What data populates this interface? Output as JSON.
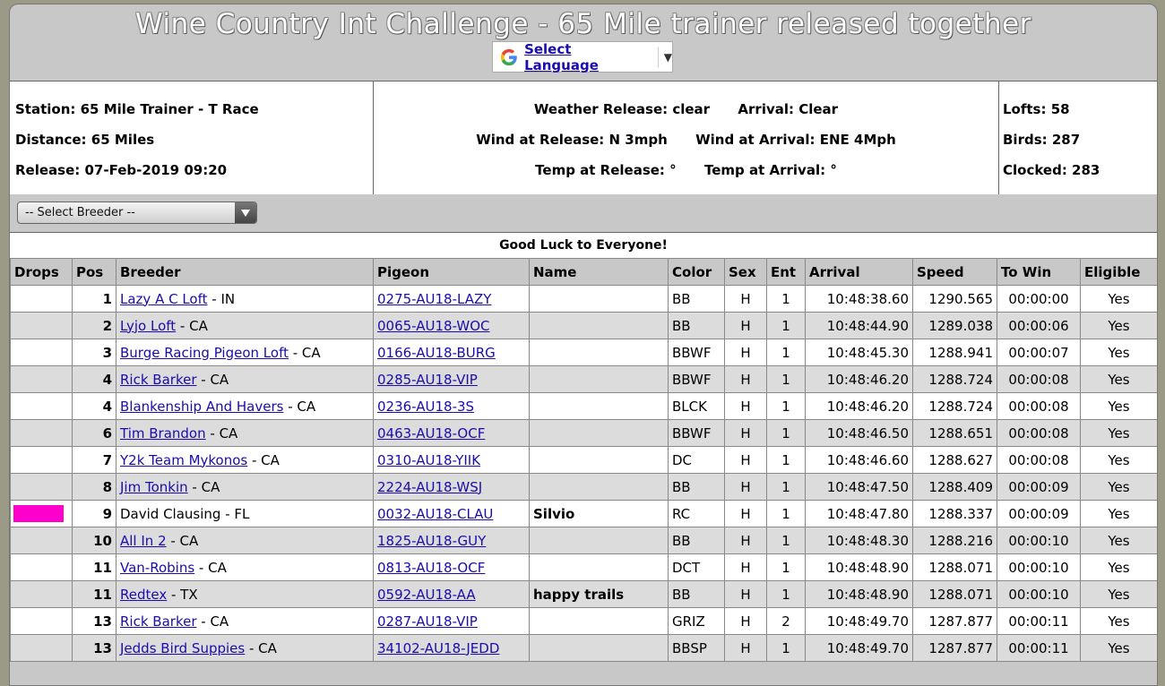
{
  "title": "Wine Country Int Challenge - 65 Mile trainer released together",
  "language": {
    "label": "Select Language",
    "arrow": "▼"
  },
  "info": {
    "station": "Station: 65 Mile Trainer - T Race",
    "distance": "Distance: 65 Miles",
    "release": "Release: 07-Feb-2019 09:20",
    "weather": "Weather Release: clear      Arrival: Clear",
    "wind": "Wind at Release: N 3mph      Wind at Arrival: ENE 4Mph",
    "temp": "Temp at Release: °      Temp at Arrival: °",
    "lofts": "Lofts: 58",
    "birds": "Birds: 287",
    "clocked": "Clocked: 283"
  },
  "breeder_select": "-- Select Breeder --",
  "message": "Good Luck to Everyone!",
  "columns": [
    "Drops",
    "Pos",
    "Breeder",
    "Pigeon",
    "Name",
    "Color",
    "Sex",
    "Ent",
    "Arrival",
    "Speed",
    "To Win",
    "Eligible"
  ],
  "colors": {
    "drop_highlight": "#ff00cc",
    "link": "#1a0dab"
  },
  "rows": [
    {
      "drop": "",
      "pos": "1",
      "breeder": "Lazy A C Loft",
      "breeder_link": true,
      "state": " - IN",
      "pigeon": "0275-AU18-LAZY",
      "name": "",
      "color": "BB",
      "sex": "H",
      "ent": "1",
      "arrival": "10:48:38.60",
      "speed": "1290.565",
      "towin": "00:00:00",
      "eligible": "Yes"
    },
    {
      "drop": "",
      "pos": "2",
      "breeder": "Lyjo Loft",
      "breeder_link": true,
      "state": " - CA",
      "pigeon": "0065-AU18-WOC",
      "name": "",
      "color": "BB",
      "sex": "H",
      "ent": "1",
      "arrival": "10:48:44.90",
      "speed": "1289.038",
      "towin": "00:00:06",
      "eligible": "Yes"
    },
    {
      "drop": "",
      "pos": "3",
      "breeder": "Burge Racing Pigeon Loft",
      "breeder_link": true,
      "state": " - CA",
      "pigeon": "0166-AU18-BURG",
      "name": "",
      "color": "BBWF",
      "sex": "H",
      "ent": "1",
      "arrival": "10:48:45.30",
      "speed": "1288.941",
      "towin": "00:00:07",
      "eligible": "Yes"
    },
    {
      "drop": "",
      "pos": "4",
      "breeder": "Rick Barker",
      "breeder_link": true,
      "state": " - CA",
      "pigeon": "0285-AU18-VIP",
      "name": "",
      "color": "BBWF",
      "sex": "H",
      "ent": "1",
      "arrival": "10:48:46.20",
      "speed": "1288.724",
      "towin": "00:00:08",
      "eligible": "Yes"
    },
    {
      "drop": "",
      "pos": "4",
      "breeder": "Blankenship And Havers",
      "breeder_link": true,
      "state": " - CA",
      "pigeon": "0236-AU18-3S",
      "name": "",
      "color": "BLCK",
      "sex": "H",
      "ent": "1",
      "arrival": "10:48:46.20",
      "speed": "1288.724",
      "towin": "00:00:08",
      "eligible": "Yes"
    },
    {
      "drop": "",
      "pos": "6",
      "breeder": "Tim Brandon",
      "breeder_link": true,
      "state": " - CA",
      "pigeon": "0463-AU18-OCF",
      "name": "",
      "color": "BBWF",
      "sex": "H",
      "ent": "1",
      "arrival": "10:48:46.50",
      "speed": "1288.651",
      "towin": "00:00:08",
      "eligible": "Yes"
    },
    {
      "drop": "",
      "pos": "7",
      "breeder": "Y2k Team Mykonos",
      "breeder_link": true,
      "state": " - CA",
      "pigeon": "0310-AU18-YIIK",
      "name": "",
      "color": "DC",
      "sex": "H",
      "ent": "1",
      "arrival": "10:48:46.60",
      "speed": "1288.627",
      "towin": "00:00:08",
      "eligible": "Yes"
    },
    {
      "drop": "",
      "pos": "8",
      "breeder": "Jim Tonkin",
      "breeder_link": true,
      "state": " - CA",
      "pigeon": "2224-AU18-WSJ",
      "name": "",
      "color": "BB",
      "sex": "H",
      "ent": "1",
      "arrival": "10:48:47.50",
      "speed": "1288.409",
      "towin": "00:00:09",
      "eligible": "Yes"
    },
    {
      "drop": "mark",
      "pos": "9",
      "breeder": "David Clausing",
      "breeder_link": false,
      "state": " - FL",
      "pigeon": "0032-AU18-CLAU",
      "name": "Silvio",
      "color": "RC",
      "sex": "H",
      "ent": "1",
      "arrival": "10:48:47.80",
      "speed": "1288.337",
      "towin": "00:00:09",
      "eligible": "Yes"
    },
    {
      "drop": "",
      "pos": "10",
      "breeder": "All In 2",
      "breeder_link": true,
      "state": " - CA",
      "pigeon": "1825-AU18-GUY",
      "name": "",
      "color": "BB",
      "sex": "H",
      "ent": "1",
      "arrival": "10:48:48.30",
      "speed": "1288.216",
      "towin": "00:00:10",
      "eligible": "Yes"
    },
    {
      "drop": "",
      "pos": "11",
      "breeder": "Van-Robins",
      "breeder_link": true,
      "state": " - CA",
      "pigeon": "0813-AU18-OCF",
      "name": "",
      "color": "DCT",
      "sex": "H",
      "ent": "1",
      "arrival": "10:48:48.90",
      "speed": "1288.071",
      "towin": "00:00:10",
      "eligible": "Yes"
    },
    {
      "drop": "",
      "pos": "11",
      "breeder": "Redtex",
      "breeder_link": true,
      "state": " - TX",
      "pigeon": "0592-AU18-AA",
      "name": "happy trails",
      "color": "BB",
      "sex": "H",
      "ent": "1",
      "arrival": "10:48:48.90",
      "speed": "1288.071",
      "towin": "00:00:10",
      "eligible": "Yes"
    },
    {
      "drop": "",
      "pos": "13",
      "breeder": "Rick Barker",
      "breeder_link": true,
      "state": " - CA",
      "pigeon": "0287-AU18-VIP",
      "name": "",
      "color": "GRIZ",
      "sex": "H",
      "ent": "2",
      "arrival": "10:48:49.70",
      "speed": "1287.877",
      "towin": "00:00:11",
      "eligible": "Yes"
    },
    {
      "drop": "",
      "pos": "13",
      "breeder": "Jedds Bird Suppies",
      "breeder_link": true,
      "state": " - CA",
      "pigeon": "34102-AU18-JEDD",
      "name": "",
      "color": "BBSP",
      "sex": "H",
      "ent": "1",
      "arrival": "10:48:49.70",
      "speed": "1287.877",
      "towin": "00:00:11",
      "eligible": "Yes"
    }
  ]
}
